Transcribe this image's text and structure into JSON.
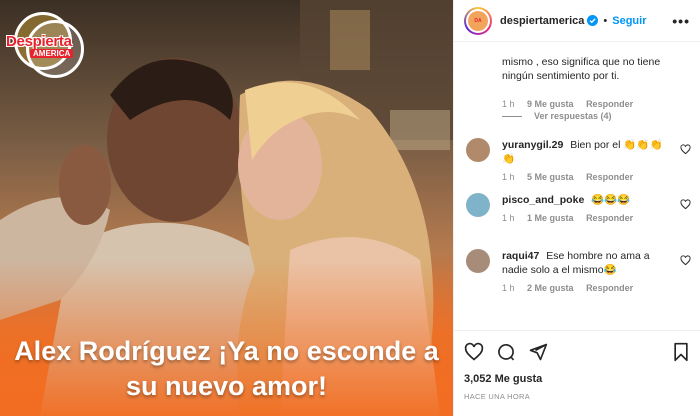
{
  "media": {
    "logo_text": "Despierta",
    "logo_sub": "AMERICA",
    "headline": "Alex Rodríguez ¡Ya no esconde a su nuevo amor!"
  },
  "header": {
    "username": "despiertamerica",
    "follow_label": "Seguir",
    "more_label": "•••"
  },
  "thread": {
    "first_reply_text": "mismo , eso significa que no tiene ningún sentimiento por ti.",
    "first_reply_time": "1 h",
    "first_reply_likes": "9 Me gusta",
    "first_reply_reply": "Responder",
    "view_replies": "Ver respuestas (4)"
  },
  "comments": [
    {
      "user": "yuranygil.29",
      "text": "Bien por el 👏👏👏👏",
      "time": "1 h",
      "likes": "5 Me gusta",
      "reply": "Responder",
      "avatar_color": "#b08a6a"
    },
    {
      "user": "pisco_and_poke",
      "text": "😂😂😂",
      "time": "1 h",
      "likes": "1 Me gusta",
      "reply": "Responder",
      "avatar_color": "#7fb3c9"
    },
    {
      "user": "raqui47",
      "text": "Ese hombre no ama a nadie solo a el mismo😂",
      "time": "1 h",
      "likes": "2 Me gusta",
      "reply": "Responder",
      "avatar_color": "#a88c7a"
    }
  ],
  "stats": {
    "likes": "3,052 Me gusta",
    "time": "HACE UNA HORA"
  },
  "colors": {
    "accent": "#0095f6",
    "brand_red": "#e8232e",
    "overlay_orange": "#f26d21"
  }
}
